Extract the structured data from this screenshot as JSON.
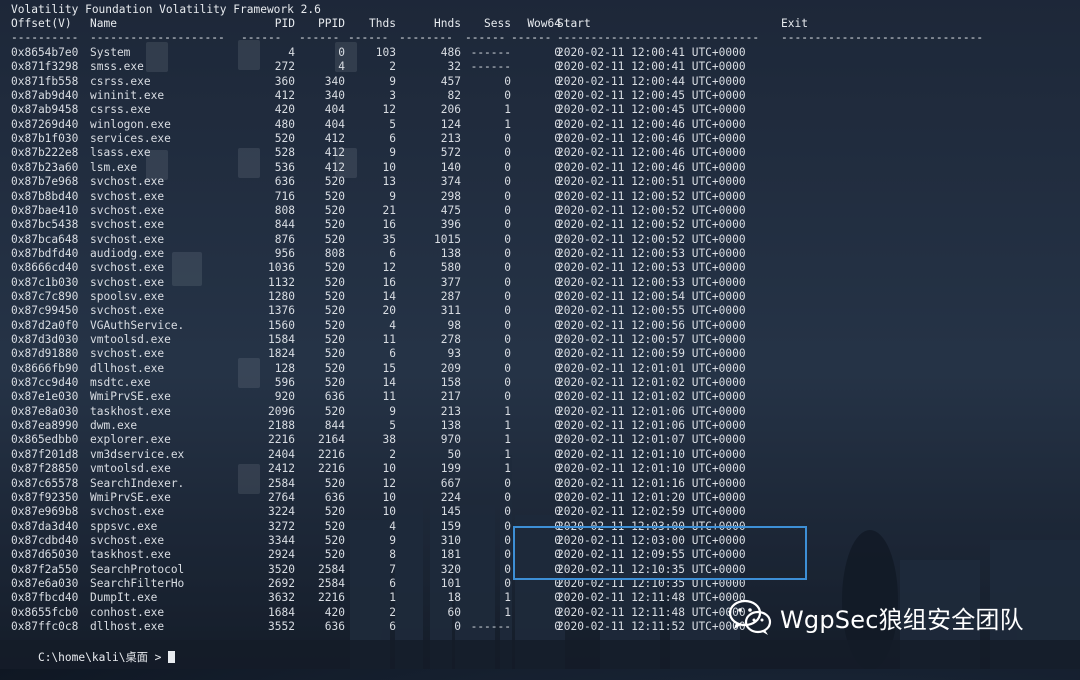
{
  "terminal": {
    "banner": "Volatility Foundation Volatility Framework 2.6",
    "columns": [
      "Offset(V)",
      "Name",
      "PID",
      "PPID",
      "Thds",
      "Hnds",
      "Sess",
      "Wow64",
      "Start",
      "Exit"
    ],
    "separators": [
      "----------",
      "--------------------",
      "------",
      "------",
      "------",
      "--------",
      "------",
      "------",
      "------------------------------",
      "------------------------------"
    ],
    "rows": [
      [
        "0x8654b7e0",
        "System",
        "4",
        "0",
        "103",
        "486",
        "------",
        "0",
        "2020-02-11 12:00:41 UTC+0000",
        ""
      ],
      [
        "0x871f3298",
        "smss.exe",
        "272",
        "4",
        "2",
        "32",
        "------",
        "0",
        "2020-02-11 12:00:41 UTC+0000",
        ""
      ],
      [
        "0x871fb558",
        "csrss.exe",
        "360",
        "340",
        "9",
        "457",
        "0",
        "0",
        "2020-02-11 12:00:44 UTC+0000",
        ""
      ],
      [
        "0x87ab9d40",
        "wininit.exe",
        "412",
        "340",
        "3",
        "82",
        "0",
        "0",
        "2020-02-11 12:00:45 UTC+0000",
        ""
      ],
      [
        "0x87ab9458",
        "csrss.exe",
        "420",
        "404",
        "12",
        "206",
        "1",
        "0",
        "2020-02-11 12:00:45 UTC+0000",
        ""
      ],
      [
        "0x87269d40",
        "winlogon.exe",
        "480",
        "404",
        "5",
        "124",
        "1",
        "0",
        "2020-02-11 12:00:46 UTC+0000",
        ""
      ],
      [
        "0x87b1f030",
        "services.exe",
        "520",
        "412",
        "6",
        "213",
        "0",
        "0",
        "2020-02-11 12:00:46 UTC+0000",
        ""
      ],
      [
        "0x87b222e8",
        "lsass.exe",
        "528",
        "412",
        "9",
        "572",
        "0",
        "0",
        "2020-02-11 12:00:46 UTC+0000",
        ""
      ],
      [
        "0x87b23a60",
        "lsm.exe",
        "536",
        "412",
        "10",
        "140",
        "0",
        "0",
        "2020-02-11 12:00:46 UTC+0000",
        ""
      ],
      [
        "0x87b7e968",
        "svchost.exe",
        "636",
        "520",
        "13",
        "374",
        "0",
        "0",
        "2020-02-11 12:00:51 UTC+0000",
        ""
      ],
      [
        "0x87b8bd40",
        "svchost.exe",
        "716",
        "520",
        "9",
        "298",
        "0",
        "0",
        "2020-02-11 12:00:52 UTC+0000",
        ""
      ],
      [
        "0x87bae410",
        "svchost.exe",
        "808",
        "520",
        "21",
        "475",
        "0",
        "0",
        "2020-02-11 12:00:52 UTC+0000",
        ""
      ],
      [
        "0x87bc5438",
        "svchost.exe",
        "844",
        "520",
        "16",
        "396",
        "0",
        "0",
        "2020-02-11 12:00:52 UTC+0000",
        ""
      ],
      [
        "0x87bca648",
        "svchost.exe",
        "876",
        "520",
        "35",
        "1015",
        "0",
        "0",
        "2020-02-11 12:00:52 UTC+0000",
        ""
      ],
      [
        "0x87bdfd40",
        "audiodg.exe",
        "956",
        "808",
        "6",
        "138",
        "0",
        "0",
        "2020-02-11 12:00:53 UTC+0000",
        ""
      ],
      [
        "0x8666cd40",
        "svchost.exe",
        "1036",
        "520",
        "12",
        "580",
        "0",
        "0",
        "2020-02-11 12:00:53 UTC+0000",
        ""
      ],
      [
        "0x87c1b030",
        "svchost.exe",
        "1132",
        "520",
        "16",
        "377",
        "0",
        "0",
        "2020-02-11 12:00:53 UTC+0000",
        ""
      ],
      [
        "0x87c7c890",
        "spoolsv.exe",
        "1280",
        "520",
        "14",
        "287",
        "0",
        "0",
        "2020-02-11 12:00:54 UTC+0000",
        ""
      ],
      [
        "0x87c99450",
        "svchost.exe",
        "1376",
        "520",
        "20",
        "311",
        "0",
        "0",
        "2020-02-11 12:00:55 UTC+0000",
        ""
      ],
      [
        "0x87d2a0f0",
        "VGAuthService.",
        "1560",
        "520",
        "4",
        "98",
        "0",
        "0",
        "2020-02-11 12:00:56 UTC+0000",
        ""
      ],
      [
        "0x87d3d030",
        "vmtoolsd.exe",
        "1584",
        "520",
        "11",
        "278",
        "0",
        "0",
        "2020-02-11 12:00:57 UTC+0000",
        ""
      ],
      [
        "0x87d91880",
        "svchost.exe",
        "1824",
        "520",
        "6",
        "93",
        "0",
        "0",
        "2020-02-11 12:00:59 UTC+0000",
        ""
      ],
      [
        "0x8666fb90",
        "dllhost.exe",
        "128",
        "520",
        "15",
        "209",
        "0",
        "0",
        "2020-02-11 12:01:01 UTC+0000",
        ""
      ],
      [
        "0x87cc9d40",
        "msdtc.exe",
        "596",
        "520",
        "14",
        "158",
        "0",
        "0",
        "2020-02-11 12:01:02 UTC+0000",
        ""
      ],
      [
        "0x87e1e030",
        "WmiPrvSE.exe",
        "920",
        "636",
        "11",
        "217",
        "0",
        "0",
        "2020-02-11 12:01:02 UTC+0000",
        ""
      ],
      [
        "0x87e8a030",
        "taskhost.exe",
        "2096",
        "520",
        "9",
        "213",
        "1",
        "0",
        "2020-02-11 12:01:06 UTC+0000",
        ""
      ],
      [
        "0x87ea8990",
        "dwm.exe",
        "2188",
        "844",
        "5",
        "138",
        "1",
        "0",
        "2020-02-11 12:01:06 UTC+0000",
        ""
      ],
      [
        "0x865edbb0",
        "explorer.exe",
        "2216",
        "2164",
        "38",
        "970",
        "1",
        "0",
        "2020-02-11 12:01:07 UTC+0000",
        ""
      ],
      [
        "0x87f201d8",
        "vm3dservice.ex",
        "2404",
        "2216",
        "2",
        "50",
        "1",
        "0",
        "2020-02-11 12:01:10 UTC+0000",
        ""
      ],
      [
        "0x87f28850",
        "vmtoolsd.exe",
        "2412",
        "2216",
        "10",
        "199",
        "1",
        "0",
        "2020-02-11 12:01:10 UTC+0000",
        ""
      ],
      [
        "0x87c65578",
        "SearchIndexer.",
        "2584",
        "520",
        "12",
        "667",
        "0",
        "0",
        "2020-02-11 12:01:16 UTC+0000",
        ""
      ],
      [
        "0x87f92350",
        "WmiPrvSE.exe",
        "2764",
        "636",
        "10",
        "224",
        "0",
        "0",
        "2020-02-11 12:01:20 UTC+0000",
        ""
      ],
      [
        "0x87e969b8",
        "svchost.exe",
        "3224",
        "520",
        "10",
        "145",
        "0",
        "0",
        "2020-02-11 12:02:59 UTC+0000",
        ""
      ],
      [
        "0x87da3d40",
        "sppsvc.exe",
        "3272",
        "520",
        "4",
        "159",
        "0",
        "0",
        "2020-02-11 12:03:00 UTC+0000",
        ""
      ],
      [
        "0x87cdbd40",
        "svchost.exe",
        "3344",
        "520",
        "9",
        "310",
        "0",
        "0",
        "2020-02-11 12:03:00 UTC+0000",
        ""
      ],
      [
        "0x87d65030",
        "taskhost.exe",
        "2924",
        "520",
        "8",
        "181",
        "0",
        "0",
        "2020-02-11 12:09:55 UTC+0000",
        ""
      ],
      [
        "0x87f2a550",
        "SearchProtocol",
        "3520",
        "2584",
        "7",
        "320",
        "0",
        "0",
        "2020-02-11 12:10:35 UTC+0000",
        ""
      ],
      [
        "0x87e6a030",
        "SearchFilterHo",
        "2692",
        "2584",
        "6",
        "101",
        "0",
        "0",
        "2020-02-11 12:10:35 UTC+0000",
        ""
      ],
      [
        "0x87fbcd40",
        "DumpIt.exe",
        "3632",
        "2216",
        "1",
        "18",
        "1",
        "0",
        "2020-02-11 12:11:48 UTC+0000",
        ""
      ],
      [
        "0x8655fcb0",
        "conhost.exe",
        "1684",
        "420",
        "2",
        "60",
        "1",
        "0",
        "2020-02-11 12:11:48 UTC+0000",
        ""
      ],
      [
        "0x87ffc0c8",
        "dllhost.exe",
        "3552",
        "636",
        "6",
        "0",
        "------",
        "0",
        "2020-02-11 12:11:52 UTC+0000",
        ""
      ]
    ],
    "prompt": "C:\\home\\kali\\桌面 > "
  },
  "watermark": {
    "text": "WgpSec狼组安全团队",
    "icon": "wechat-icon"
  },
  "colors": {
    "text": "#d9dde3",
    "highlight_border": "#3d8fd6",
    "watermark_text": "#ffffff"
  }
}
